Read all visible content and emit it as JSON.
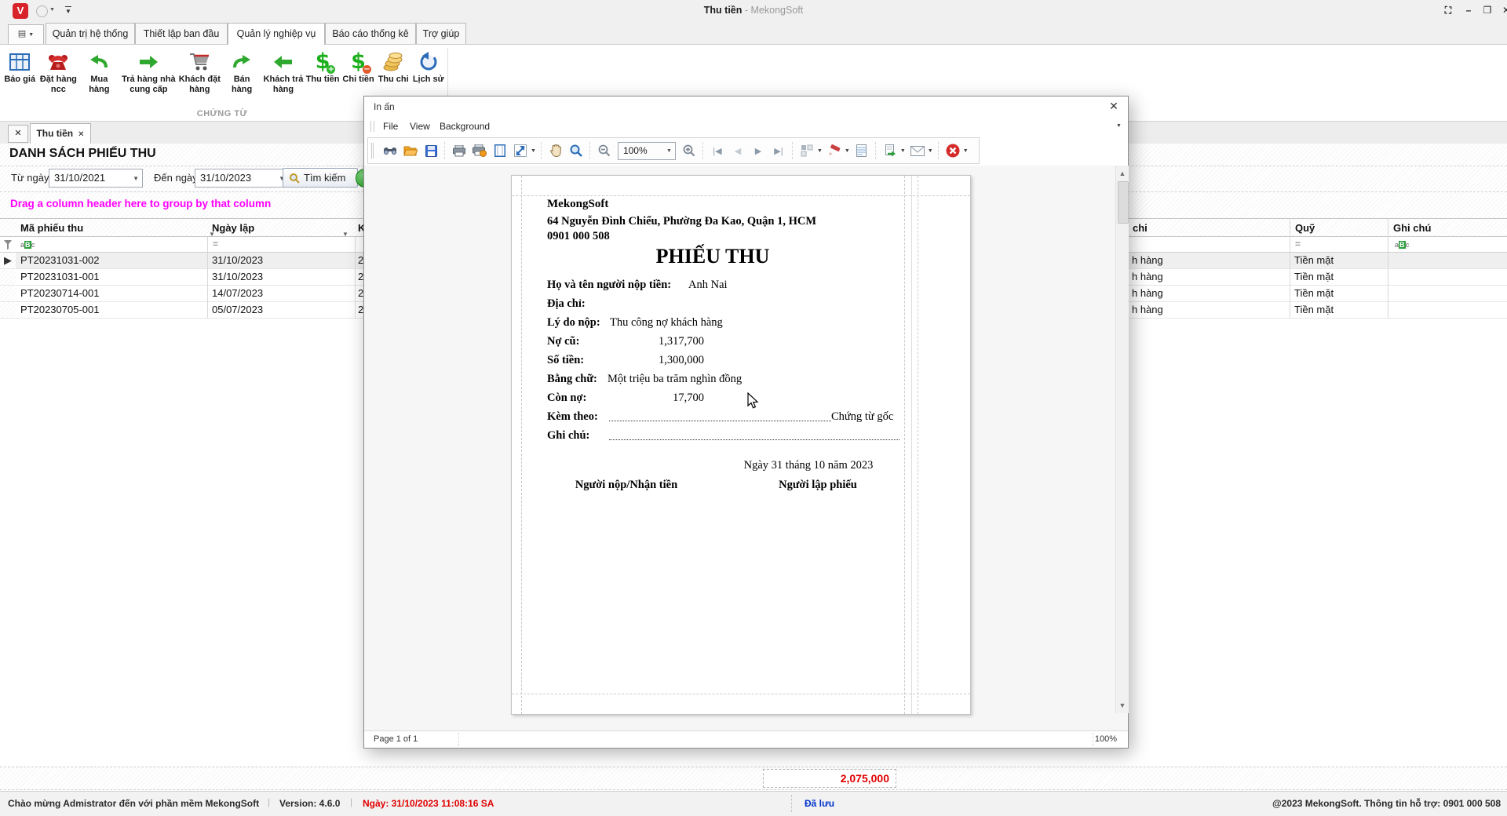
{
  "title_bar": {
    "app_title": "Thu tiền",
    "app_subtitle": "- MekongSoft"
  },
  "ribbon": {
    "tabs": [
      {
        "label": "Quản trị hệ thống"
      },
      {
        "label": "Thiết lập ban đầu"
      },
      {
        "label": "Quản lý nghiệp vụ"
      },
      {
        "label": "Báo cáo thống kê"
      },
      {
        "label": "Trợ giúp"
      }
    ],
    "group_label": "CHỨNG TỪ",
    "buttons": [
      {
        "label": "Báo giá"
      },
      {
        "label": "Đặt hàng ncc"
      },
      {
        "label": "Mua hàng"
      },
      {
        "label": "Trả hàng nhà cung cấp"
      },
      {
        "label": "Khách đặt hàng"
      },
      {
        "label": "Bán hàng"
      },
      {
        "label": "Khách trả hàng"
      },
      {
        "label": "Thu tiền"
      },
      {
        "label": "Chi tiền"
      },
      {
        "label": "Thu chi"
      },
      {
        "label": "Lịch sử"
      }
    ]
  },
  "document_tabs": {
    "active": "Thu tiền"
  },
  "page": {
    "heading": "DANH SÁCH PHIẾU THU",
    "filter": {
      "from_label": "Từ ngày",
      "from_value": "31/10/2021",
      "to_label": "Đến ngày",
      "to_value": "31/10/2023",
      "search_label": "Tìm kiếm"
    },
    "group_hint": "Drag a column header here to group by that column",
    "grid": {
      "col_code": "Mã phiếu thu",
      "col_date": "Ngày lập",
      "col3_fragment": "K",
      "col_reason_fragment": "chi",
      "col_fund": "Quỹ",
      "col_note": "Ghi chú",
      "rows": [
        {
          "code": "PT20231031-002",
          "date": "31/10/2023",
          "col3": "2",
          "reason": "h hàng",
          "fund": "Tiền mặt",
          "note": ""
        },
        {
          "code": "PT20231031-001",
          "date": "31/10/2023",
          "col3": "2",
          "reason": "h hàng",
          "fund": "Tiền mặt",
          "note": ""
        },
        {
          "code": "PT20230714-001",
          "date": "14/07/2023",
          "col3": "2",
          "reason": "h hàng",
          "fund": "Tiền mặt",
          "note": ""
        },
        {
          "code": "PT20230705-001",
          "date": "05/07/2023",
          "col3": "2",
          "reason": "h hàng",
          "fund": "Tiền mặt",
          "note": ""
        }
      ],
      "footer_total": "2,075,000"
    }
  },
  "print_dialog": {
    "title": "In ấn",
    "menu": [
      "File",
      "View",
      "Background"
    ],
    "zoom_value": "100%",
    "status_left": "Page 1 of 1",
    "status_right": "100%",
    "receipt": {
      "company": "MekongSoft",
      "address": "64 Nguyễn Đình Chiểu, Phường Đa Kao, Quận 1, HCM",
      "phone": "0901 000 508",
      "title": "PHIẾU THU",
      "payer_label": "Họ và tên người nộp tiền:",
      "payer": "Anh Nai",
      "address_label": "Địa chỉ:",
      "reason_label": "Lý do nộp:",
      "reason": "Thu công nợ khách hàng",
      "old_debt_label": "Nợ cũ:",
      "old_debt": "1,317,700",
      "amount_label": "Số tiền:",
      "amount": "1,300,000",
      "in_words_label": "Bằng chữ:",
      "in_words": "Một triệu ba trăm nghìn đồng",
      "remaining_label": "Còn nợ:",
      "remaining": "17,700",
      "attach_label": "Kèm theo:",
      "attach_value": "Chứng từ gốc",
      "note_label": "Ghi chú:",
      "date_line": "Ngày 31 tháng 10 năm 2023",
      "sign_left": "Người nộp/Nhận tiền",
      "sign_right": "Người lập phiếu"
    }
  },
  "status_bar": {
    "welcome": "Chào mừng Admistrator đến với phần mềm MekongSoft",
    "version": "Version: 4.6.0",
    "date": "Ngày: 31/10/2023 11:08:16 SA",
    "saved": "Đã lưu",
    "support": "@2023 MekongSoft. Thông tin hỗ trợ: 0901 000 508"
  }
}
